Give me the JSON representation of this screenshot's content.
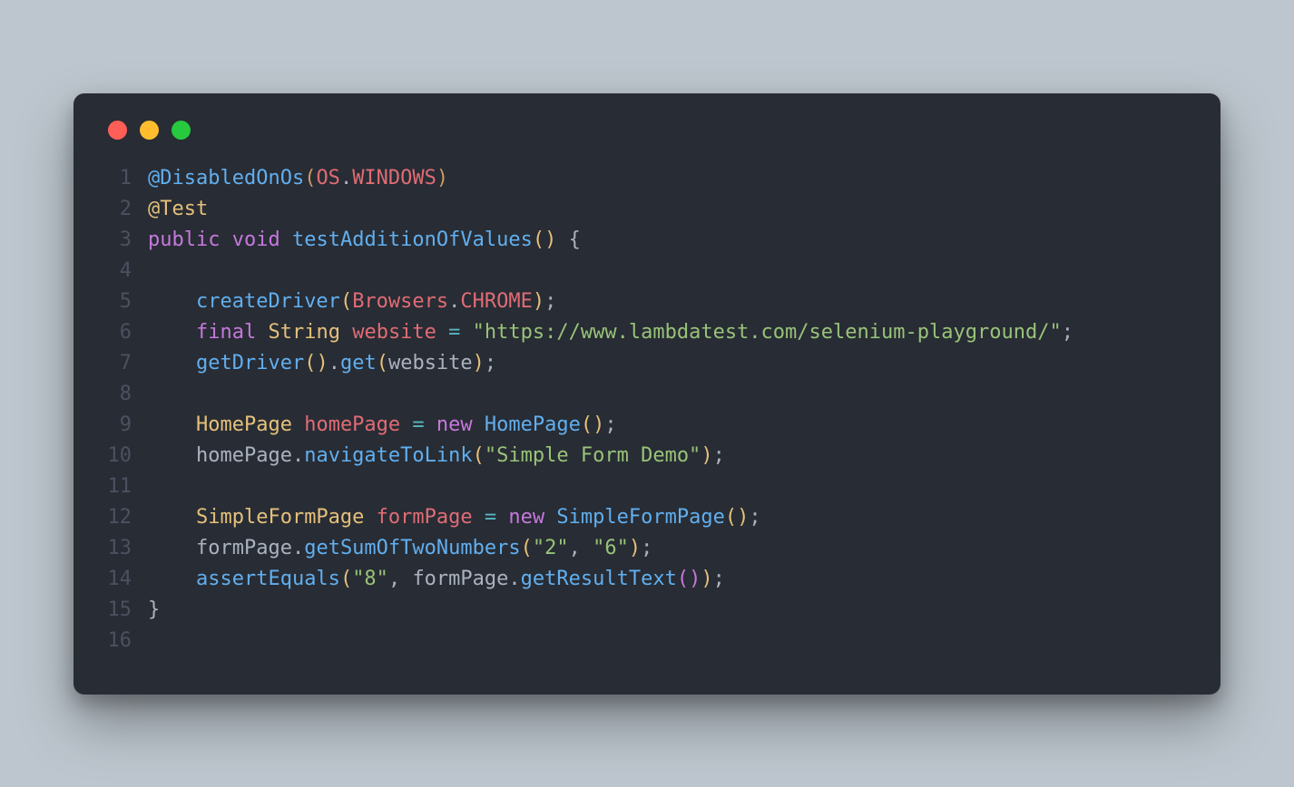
{
  "window": {
    "traffic_light_colors": {
      "close": "#ff5f56",
      "minimize": "#ffbd2e",
      "zoom": "#27c93f"
    }
  },
  "gutter": [
    "1",
    "2",
    "3",
    "4",
    "5",
    "6",
    "7",
    "8",
    "9",
    "10",
    "11",
    "12",
    "13",
    "14",
    "15",
    "16"
  ],
  "code": {
    "language": "java",
    "lines": [
      [
        {
          "t": "@DisabledOnOs",
          "c": "c-blue"
        },
        {
          "t": "(",
          "c": "c-orange"
        },
        {
          "t": "OS",
          "c": "c-red"
        },
        {
          "t": ".",
          "c": "c-default"
        },
        {
          "t": "WINDOWS",
          "c": "c-red"
        },
        {
          "t": ")",
          "c": "c-orange"
        }
      ],
      [
        {
          "t": "@Test",
          "c": "c-yellow"
        }
      ],
      [
        {
          "t": "public",
          "c": "c-purple"
        },
        {
          "t": " ",
          "c": "c-default"
        },
        {
          "t": "void",
          "c": "c-purple"
        },
        {
          "t": " ",
          "c": "c-default"
        },
        {
          "t": "testAdditionOfValues",
          "c": "c-blue"
        },
        {
          "t": "()",
          "c": "c-yellow"
        },
        {
          "t": " {",
          "c": "c-default"
        }
      ],
      [],
      [
        {
          "t": "    ",
          "c": "c-default"
        },
        {
          "t": "createDriver",
          "c": "c-blue"
        },
        {
          "t": "(",
          "c": "c-yellow"
        },
        {
          "t": "Browsers",
          "c": "c-red"
        },
        {
          "t": ".",
          "c": "c-default"
        },
        {
          "t": "CHROME",
          "c": "c-red"
        },
        {
          "t": ")",
          "c": "c-yellow"
        },
        {
          "t": ";",
          "c": "c-default"
        }
      ],
      [
        {
          "t": "    ",
          "c": "c-default"
        },
        {
          "t": "final",
          "c": "c-purple"
        },
        {
          "t": " ",
          "c": "c-default"
        },
        {
          "t": "String",
          "c": "c-yellow"
        },
        {
          "t": " ",
          "c": "c-default"
        },
        {
          "t": "website",
          "c": "c-red"
        },
        {
          "t": " ",
          "c": "c-default"
        },
        {
          "t": "=",
          "c": "c-cyan"
        },
        {
          "t": " ",
          "c": "c-default"
        },
        {
          "t": "\"https://www.lambdatest.com/selenium-playground/\"",
          "c": "c-green"
        },
        {
          "t": ";",
          "c": "c-default"
        }
      ],
      [
        {
          "t": "    ",
          "c": "c-default"
        },
        {
          "t": "getDriver",
          "c": "c-blue"
        },
        {
          "t": "()",
          "c": "c-yellow"
        },
        {
          "t": ".",
          "c": "c-default"
        },
        {
          "t": "get",
          "c": "c-blue"
        },
        {
          "t": "(",
          "c": "c-yellow"
        },
        {
          "t": "website",
          "c": "c-default"
        },
        {
          "t": ")",
          "c": "c-yellow"
        },
        {
          "t": ";",
          "c": "c-default"
        }
      ],
      [],
      [
        {
          "t": "    ",
          "c": "c-default"
        },
        {
          "t": "HomePage",
          "c": "c-yellow"
        },
        {
          "t": " ",
          "c": "c-default"
        },
        {
          "t": "homePage",
          "c": "c-red"
        },
        {
          "t": " ",
          "c": "c-default"
        },
        {
          "t": "=",
          "c": "c-cyan"
        },
        {
          "t": " ",
          "c": "c-default"
        },
        {
          "t": "new",
          "c": "c-purple"
        },
        {
          "t": " ",
          "c": "c-default"
        },
        {
          "t": "HomePage",
          "c": "c-blue"
        },
        {
          "t": "()",
          "c": "c-yellow"
        },
        {
          "t": ";",
          "c": "c-default"
        }
      ],
      [
        {
          "t": "    ",
          "c": "c-default"
        },
        {
          "t": "homePage",
          "c": "c-default"
        },
        {
          "t": ".",
          "c": "c-default"
        },
        {
          "t": "navigateToLink",
          "c": "c-blue"
        },
        {
          "t": "(",
          "c": "c-yellow"
        },
        {
          "t": "\"Simple Form Demo\"",
          "c": "c-green"
        },
        {
          "t": ")",
          "c": "c-yellow"
        },
        {
          "t": ";",
          "c": "c-default"
        }
      ],
      [],
      [
        {
          "t": "    ",
          "c": "c-default"
        },
        {
          "t": "SimpleFormPage",
          "c": "c-yellow"
        },
        {
          "t": " ",
          "c": "c-default"
        },
        {
          "t": "formPage",
          "c": "c-red"
        },
        {
          "t": " ",
          "c": "c-default"
        },
        {
          "t": "=",
          "c": "c-cyan"
        },
        {
          "t": " ",
          "c": "c-default"
        },
        {
          "t": "new",
          "c": "c-purple"
        },
        {
          "t": " ",
          "c": "c-default"
        },
        {
          "t": "SimpleFormPage",
          "c": "c-blue"
        },
        {
          "t": "()",
          "c": "c-yellow"
        },
        {
          "t": ";",
          "c": "c-default"
        }
      ],
      [
        {
          "t": "    ",
          "c": "c-default"
        },
        {
          "t": "formPage",
          "c": "c-default"
        },
        {
          "t": ".",
          "c": "c-default"
        },
        {
          "t": "getSumOfTwoNumbers",
          "c": "c-blue"
        },
        {
          "t": "(",
          "c": "c-yellow"
        },
        {
          "t": "\"2\"",
          "c": "c-green"
        },
        {
          "t": ", ",
          "c": "c-default"
        },
        {
          "t": "\"6\"",
          "c": "c-green"
        },
        {
          "t": ")",
          "c": "c-yellow"
        },
        {
          "t": ";",
          "c": "c-default"
        }
      ],
      [
        {
          "t": "    ",
          "c": "c-default"
        },
        {
          "t": "assertEquals",
          "c": "c-blue"
        },
        {
          "t": "(",
          "c": "c-yellow"
        },
        {
          "t": "\"8\"",
          "c": "c-green"
        },
        {
          "t": ", ",
          "c": "c-default"
        },
        {
          "t": "formPage",
          "c": "c-default"
        },
        {
          "t": ".",
          "c": "c-default"
        },
        {
          "t": "getResultText",
          "c": "c-blue"
        },
        {
          "t": "()",
          "c": "c-purple"
        },
        {
          "t": ")",
          "c": "c-yellow"
        },
        {
          "t": ";",
          "c": "c-default"
        }
      ],
      [
        {
          "t": "}",
          "c": "c-default"
        }
      ],
      []
    ]
  }
}
